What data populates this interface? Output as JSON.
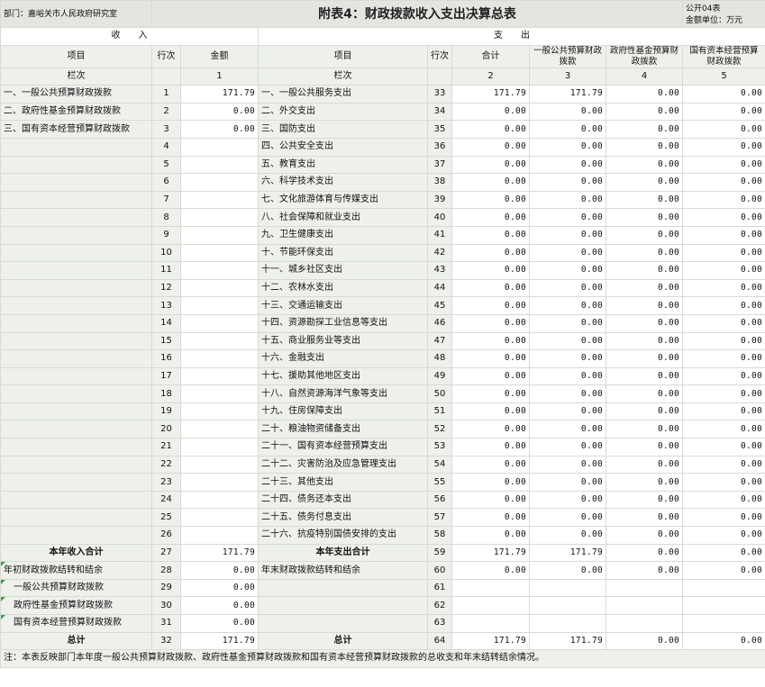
{
  "header": {
    "department": "部门：嘉峪关市人民政府研究室",
    "title": "附表4：财政拨款收入支出决算总表",
    "form_code": "公开04表",
    "unit": "金额单位：万元"
  },
  "sections": {
    "income": "收　　入",
    "expense": "支　　出"
  },
  "columns": {
    "item": "项目",
    "row_no": "行次",
    "amount": "金额",
    "total": "合计",
    "general_budget": "一般公共预算财政拨款",
    "fund_budget": "政府性基金预算财政拨款",
    "capital_budget": "国有资本经营预算财政拨款"
  },
  "column_numbers": {
    "label": "栏次",
    "c1": "1",
    "c2": "2",
    "c3": "3",
    "c4": "4",
    "c5": "5"
  },
  "rows": [
    {
      "in_item": "一、一般公共预算财政拨款",
      "in_no": "1",
      "in_amt": "171.79",
      "ex_item": "一、一般公共服务支出",
      "ex_no": "33",
      "t": "171.79",
      "g": "171.79",
      "f": "0.00",
      "k": "0.00"
    },
    {
      "in_item": "二、政府性基金预算财政拨款",
      "in_no": "2",
      "in_amt": "0.00",
      "ex_item": "二、外交支出",
      "ex_no": "34",
      "t": "0.00",
      "g": "0.00",
      "f": "0.00",
      "k": "0.00"
    },
    {
      "in_item": "三、国有资本经营预算财政拨款",
      "in_no": "3",
      "in_amt": "0.00",
      "ex_item": "三、国防支出",
      "ex_no": "35",
      "t": "0.00",
      "g": "0.00",
      "f": "0.00",
      "k": "0.00"
    },
    {
      "in_item": "",
      "in_no": "4",
      "in_amt": "",
      "ex_item": "四、公共安全支出",
      "ex_no": "36",
      "t": "0.00",
      "g": "0.00",
      "f": "0.00",
      "k": "0.00"
    },
    {
      "in_item": "",
      "in_no": "5",
      "in_amt": "",
      "ex_item": "五、教育支出",
      "ex_no": "37",
      "t": "0.00",
      "g": "0.00",
      "f": "0.00",
      "k": "0.00"
    },
    {
      "in_item": "",
      "in_no": "6",
      "in_amt": "",
      "ex_item": "六、科学技术支出",
      "ex_no": "38",
      "t": "0.00",
      "g": "0.00",
      "f": "0.00",
      "k": "0.00"
    },
    {
      "in_item": "",
      "in_no": "7",
      "in_amt": "",
      "ex_item": "七、文化旅游体育与传媒支出",
      "ex_no": "39",
      "t": "0.00",
      "g": "0.00",
      "f": "0.00",
      "k": "0.00"
    },
    {
      "in_item": "",
      "in_no": "8",
      "in_amt": "",
      "ex_item": "八、社会保障和就业支出",
      "ex_no": "40",
      "t": "0.00",
      "g": "0.00",
      "f": "0.00",
      "k": "0.00"
    },
    {
      "in_item": "",
      "in_no": "9",
      "in_amt": "",
      "ex_item": "九、卫生健康支出",
      "ex_no": "41",
      "t": "0.00",
      "g": "0.00",
      "f": "0.00",
      "k": "0.00"
    },
    {
      "in_item": "",
      "in_no": "10",
      "in_amt": "",
      "ex_item": "十、节能环保支出",
      "ex_no": "42",
      "t": "0.00",
      "g": "0.00",
      "f": "0.00",
      "k": "0.00"
    },
    {
      "in_item": "",
      "in_no": "11",
      "in_amt": "",
      "ex_item": "十一、城乡社区支出",
      "ex_no": "43",
      "t": "0.00",
      "g": "0.00",
      "f": "0.00",
      "k": "0.00"
    },
    {
      "in_item": "",
      "in_no": "12",
      "in_amt": "",
      "ex_item": "十二、农林水支出",
      "ex_no": "44",
      "t": "0.00",
      "g": "0.00",
      "f": "0.00",
      "k": "0.00"
    },
    {
      "in_item": "",
      "in_no": "13",
      "in_amt": "",
      "ex_item": "十三、交通运输支出",
      "ex_no": "45",
      "t": "0.00",
      "g": "0.00",
      "f": "0.00",
      "k": "0.00"
    },
    {
      "in_item": "",
      "in_no": "14",
      "in_amt": "",
      "ex_item": "十四、资源勘探工业信息等支出",
      "ex_no": "46",
      "t": "0.00",
      "g": "0.00",
      "f": "0.00",
      "k": "0.00"
    },
    {
      "in_item": "",
      "in_no": "15",
      "in_amt": "",
      "ex_item": "十五、商业服务业等支出",
      "ex_no": "47",
      "t": "0.00",
      "g": "0.00",
      "f": "0.00",
      "k": "0.00"
    },
    {
      "in_item": "",
      "in_no": "16",
      "in_amt": "",
      "ex_item": "十六、金融支出",
      "ex_no": "48",
      "t": "0.00",
      "g": "0.00",
      "f": "0.00",
      "k": "0.00"
    },
    {
      "in_item": "",
      "in_no": "17",
      "in_amt": "",
      "ex_item": "十七、援助其他地区支出",
      "ex_no": "49",
      "t": "0.00",
      "g": "0.00",
      "f": "0.00",
      "k": "0.00"
    },
    {
      "in_item": "",
      "in_no": "18",
      "in_amt": "",
      "ex_item": "十八、自然资源海洋气象等支出",
      "ex_no": "50",
      "t": "0.00",
      "g": "0.00",
      "f": "0.00",
      "k": "0.00"
    },
    {
      "in_item": "",
      "in_no": "19",
      "in_amt": "",
      "ex_item": "十九、住房保障支出",
      "ex_no": "51",
      "t": "0.00",
      "g": "0.00",
      "f": "0.00",
      "k": "0.00"
    },
    {
      "in_item": "",
      "in_no": "20",
      "in_amt": "",
      "ex_item": "二十、粮油物资储备支出",
      "ex_no": "52",
      "t": "0.00",
      "g": "0.00",
      "f": "0.00",
      "k": "0.00"
    },
    {
      "in_item": "",
      "in_no": "21",
      "in_amt": "",
      "ex_item": "二十一、国有资本经营预算支出",
      "ex_no": "53",
      "t": "0.00",
      "g": "0.00",
      "f": "0.00",
      "k": "0.00"
    },
    {
      "in_item": "",
      "in_no": "22",
      "in_amt": "",
      "ex_item": "二十二、灾害防治及应急管理支出",
      "ex_no": "54",
      "t": "0.00",
      "g": "0.00",
      "f": "0.00",
      "k": "0.00"
    },
    {
      "in_item": "",
      "in_no": "23",
      "in_amt": "",
      "ex_item": "二十三、其他支出",
      "ex_no": "55",
      "t": "0.00",
      "g": "0.00",
      "f": "0.00",
      "k": "0.00"
    },
    {
      "in_item": "",
      "in_no": "24",
      "in_amt": "",
      "ex_item": "二十四、债务还本支出",
      "ex_no": "56",
      "t": "0.00",
      "g": "0.00",
      "f": "0.00",
      "k": "0.00"
    },
    {
      "in_item": "",
      "in_no": "25",
      "in_amt": "",
      "ex_item": "二十五、债务付息支出",
      "ex_no": "57",
      "t": "0.00",
      "g": "0.00",
      "f": "0.00",
      "k": "0.00"
    },
    {
      "in_item": "",
      "in_no": "26",
      "in_amt": "",
      "ex_item": "二十六、抗疫特别国债安排的支出",
      "ex_no": "58",
      "t": "0.00",
      "g": "0.00",
      "f": "0.00",
      "k": "0.00"
    }
  ],
  "totals_year": {
    "in_item": "本年收入合计",
    "in_no": "27",
    "in_amt": "171.79",
    "ex_item": "本年支出合计",
    "ex_no": "59",
    "t": "171.79",
    "g": "171.79",
    "f": "0.00",
    "k": "0.00"
  },
  "carry": [
    {
      "in_item": "年初财政拨款结转和结余",
      "in_no": "28",
      "in_amt": "0.00",
      "ex_item": "年末财政拨款结转和结余",
      "ex_no": "60",
      "t": "0.00",
      "g": "0.00",
      "f": "0.00",
      "k": "0.00"
    },
    {
      "in_item": "一般公共预算财政拨款",
      "in_no": "29",
      "in_amt": "0.00",
      "ex_item": "",
      "ex_no": "61",
      "t": "",
      "g": "",
      "f": "",
      "k": ""
    },
    {
      "in_item": "政府性基金预算财政拨款",
      "in_no": "30",
      "in_amt": "0.00",
      "ex_item": "",
      "ex_no": "62",
      "t": "",
      "g": "",
      "f": "",
      "k": ""
    },
    {
      "in_item": "国有资本经营预算财政拨款",
      "in_no": "31",
      "in_amt": "0.00",
      "ex_item": "",
      "ex_no": "63",
      "t": "",
      "g": "",
      "f": "",
      "k": ""
    }
  ],
  "grand_total": {
    "in_item": "总计",
    "in_no": "32",
    "in_amt": "171.79",
    "ex_item": "总计",
    "ex_no": "64",
    "t": "171.79",
    "g": "171.79",
    "f": "0.00",
    "k": "0.00"
  },
  "note": "注：本表反映部门本年度一般公共预算财政拨款、政府性基金预算财政拨款和国有资本经营预算财政拨款的总收支和年末结转结余情况。"
}
